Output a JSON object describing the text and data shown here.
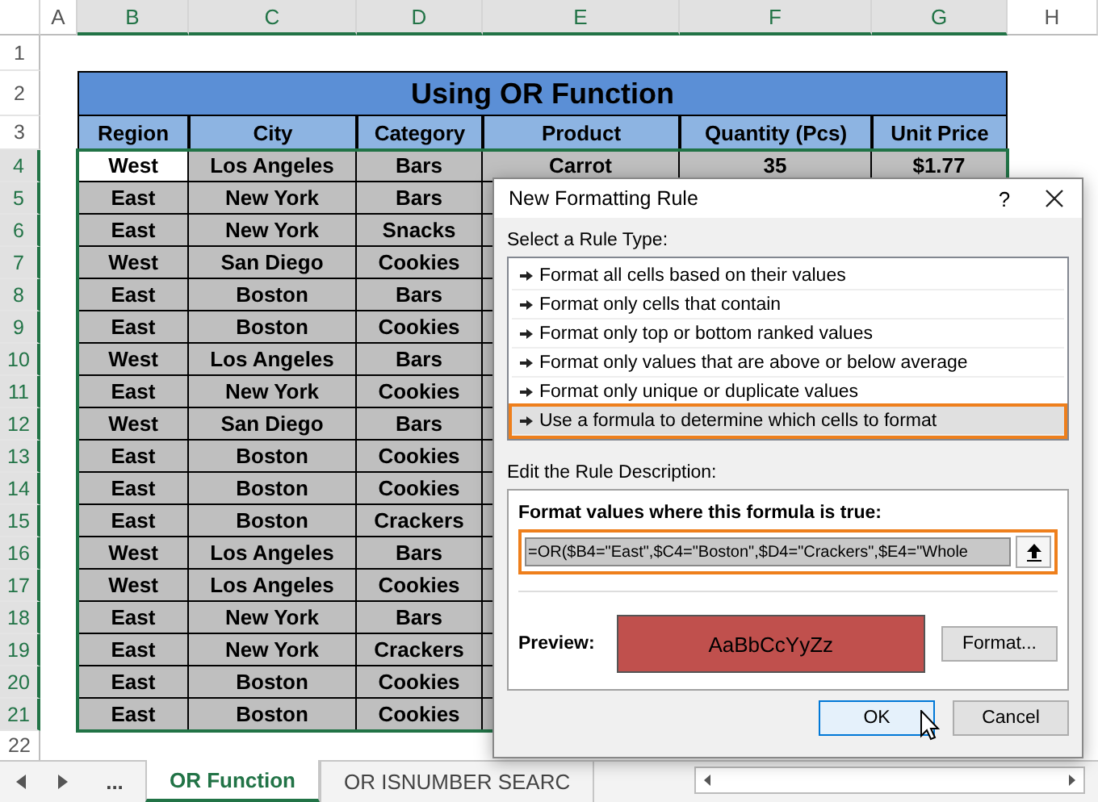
{
  "sheet": {
    "column_headers": [
      "A",
      "B",
      "C",
      "D",
      "E",
      "F",
      "G",
      "H"
    ],
    "row_numbers": [
      "1",
      "2",
      "3",
      "4",
      "5",
      "6",
      "7",
      "8",
      "9",
      "10",
      "11",
      "12",
      "13",
      "14",
      "15",
      "16",
      "17",
      "18",
      "19",
      "20",
      "21",
      "22"
    ],
    "title": "Using OR Function",
    "headers": [
      "Region",
      "City",
      "Category",
      "Product",
      "Quantity (Pcs)",
      "Unit Price"
    ],
    "rows": [
      {
        "cells": [
          "West",
          "Los Angeles",
          "Bars",
          "Carrot",
          "35",
          "$1.77"
        ],
        "selected": true
      },
      {
        "cells": [
          "East",
          "New York",
          "Bars"
        ],
        "selected": false
      },
      {
        "cells": [
          "East",
          "New York",
          "Snacks"
        ],
        "selected": false
      },
      {
        "cells": [
          "West",
          "San Diego",
          "Cookies"
        ],
        "selected": false
      },
      {
        "cells": [
          "East",
          "Boston",
          "Bars"
        ],
        "selected": false
      },
      {
        "cells": [
          "East",
          "Boston",
          "Cookies"
        ],
        "selected": false
      },
      {
        "cells": [
          "West",
          "Los Angeles",
          "Bars"
        ],
        "selected": false
      },
      {
        "cells": [
          "East",
          "New York",
          "Cookies"
        ],
        "selected": false
      },
      {
        "cells": [
          "West",
          "San Diego",
          "Bars"
        ],
        "selected": false
      },
      {
        "cells": [
          "East",
          "Boston",
          "Cookies"
        ],
        "selected": false
      },
      {
        "cells": [
          "East",
          "Boston",
          "Cookies"
        ],
        "selected": false
      },
      {
        "cells": [
          "East",
          "Boston",
          "Crackers"
        ],
        "selected": false
      },
      {
        "cells": [
          "West",
          "Los Angeles",
          "Bars"
        ],
        "selected": false
      },
      {
        "cells": [
          "West",
          "Los Angeles",
          "Cookies"
        ],
        "selected": false
      },
      {
        "cells": [
          "East",
          "New York",
          "Bars"
        ],
        "selected": false
      },
      {
        "cells": [
          "East",
          "New York",
          "Crackers"
        ],
        "selected": false
      },
      {
        "cells": [
          "East",
          "Boston",
          "Cookies"
        ],
        "selected": false
      },
      {
        "cells": [
          "East",
          "Boston",
          "Cookies"
        ],
        "selected": false
      }
    ]
  },
  "sheet_tabs": {
    "more": "...",
    "tabs": [
      {
        "label": "OR Function",
        "selected": true
      },
      {
        "label": "OR ISNUMBER SEARC",
        "selected": false
      }
    ]
  },
  "dialog": {
    "title": "New Formatting Rule",
    "help": "?",
    "rule_type_label": "Select a Rule Type:",
    "rule_types": [
      {
        "label": "Format all cells based on their values",
        "selected": false
      },
      {
        "label": "Format only cells that contain",
        "selected": false
      },
      {
        "label": "Format only top or bottom ranked values",
        "selected": false
      },
      {
        "label": "Format only values that are above or below average",
        "selected": false
      },
      {
        "label": "Format only unique or duplicate values",
        "selected": false
      },
      {
        "label": "Use a formula to determine which cells to format",
        "selected": true
      }
    ],
    "description_label": "Edit the Rule Description:",
    "formula_label": "Format values where this formula is true:",
    "formula": "=OR($B4=\"East\",$C4=\"Boston\",$D4=\"Crackers\",$E4=\"Whole",
    "preview_label": "Preview:",
    "preview_sample": "AaBbCcYyZz",
    "buttons": [
      "Format...",
      "OK",
      "Cancel"
    ]
  }
}
